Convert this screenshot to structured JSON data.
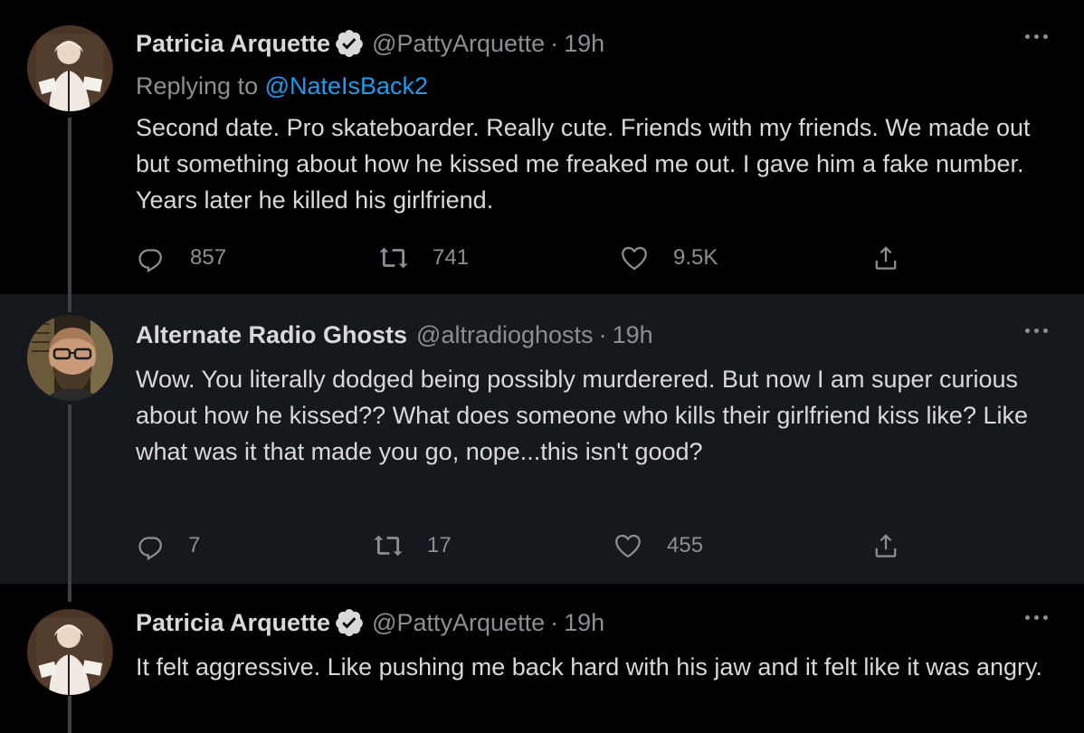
{
  "tweets": [
    {
      "name": "Patricia Arquette",
      "handle": "@PattyArquette",
      "separator": "·",
      "time": "19h",
      "replying_prefix": "Replying to ",
      "replying_to": "@NateIsBack2",
      "text": "Second date. Pro skateboarder. Really cute. Friends with my friends. We made out but something about how he kissed me freaked me out. I gave him a fake number. Years later he killed his girlfriend.",
      "replies": "857",
      "retweets": "741",
      "likes": "9.5K"
    },
    {
      "name": "Alternate Radio Ghosts",
      "handle": "@altradioghosts",
      "separator": "·",
      "time": "19h",
      "text": "Wow.  You literally dodged being possibly murderered.  But now I am super curious about how he kissed?? What does someone who kills their girlfriend kiss like?  Like what was it that made you go, nope...this isn't good?",
      "replies": "7",
      "retweets": "17",
      "likes": "455"
    },
    {
      "name": "Patricia Arquette",
      "handle": "@PattyArquette",
      "separator": "·",
      "time": "19h",
      "text": "It felt aggressive. Like pushing me back hard with his jaw and it felt like it was angry."
    }
  ],
  "icons": {
    "verified": "verified-badge-icon",
    "more": "more-options-icon",
    "reply": "reply-icon",
    "retweet": "retweet-icon",
    "like": "heart-icon",
    "share": "share-icon"
  },
  "colors": {
    "background": "#000000",
    "reply_background": "#15181c",
    "text": "#d9d9d9",
    "secondary_text": "#8b8f94",
    "mention": "#1d9bf0"
  }
}
